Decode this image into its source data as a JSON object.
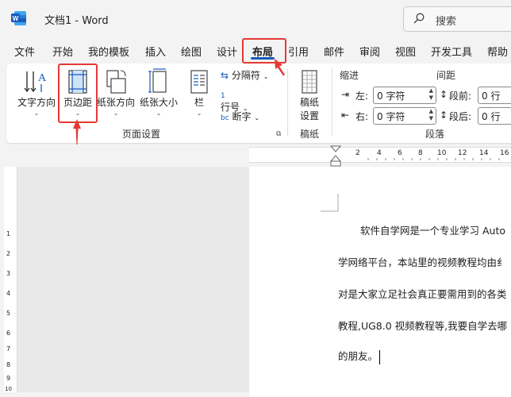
{
  "titlebar": {
    "doc_title": "文档1  -  Word",
    "search_placeholder": "搜索"
  },
  "tabs": [
    "文件",
    "开始",
    "我的模板",
    "插入",
    "绘图",
    "设计",
    "布局",
    "引用",
    "邮件",
    "审阅",
    "视图",
    "开发工具",
    "帮助"
  ],
  "ribbon": {
    "text_direction": "文字方向",
    "margins": "页边距",
    "orientation": "纸张方向",
    "size": "纸张大小",
    "columns": "栏",
    "breaks": "分隔符",
    "line_numbers": "行号",
    "hyphenation": "断字",
    "page_setup_group": "页面设置",
    "draft_setup": "稿纸\n设置",
    "draft_setup_l1": "稿纸",
    "draft_setup_l2": "设置",
    "draft_group": "稿纸",
    "indent_header": "缩进",
    "spacing_header": "间距",
    "indent_left_label": "左:",
    "indent_left_value": "0 字符",
    "indent_right_label": "右:",
    "indent_right_value": "0 字符",
    "space_before_label": "段前:",
    "space_before_value": "0 行",
    "space_after_label": "段后:",
    "space_after_value": "0 行",
    "paragraph_group": "段落"
  },
  "ruler": {
    "top_ticks": [
      "2",
      "4",
      "6",
      "8",
      "10",
      "12",
      "14",
      "16"
    ],
    "left_ticks": [
      "1",
      "2",
      "3",
      "4",
      "5",
      "6",
      "7",
      "8",
      "9",
      "10"
    ]
  },
  "document": {
    "lines": [
      "软件自学网是一个专业学习  Auto",
      "学网络平台，本站里的视频教程均由纟",
      "对是大家立足社会真正要需用到的各类",
      "教程,UG8.0  视频教程等,我要自学去哪",
      "的朋友。"
    ]
  },
  "colors": {
    "accent": "#185abd",
    "highlight": "#e53935",
    "word_blue": "#185abd"
  }
}
